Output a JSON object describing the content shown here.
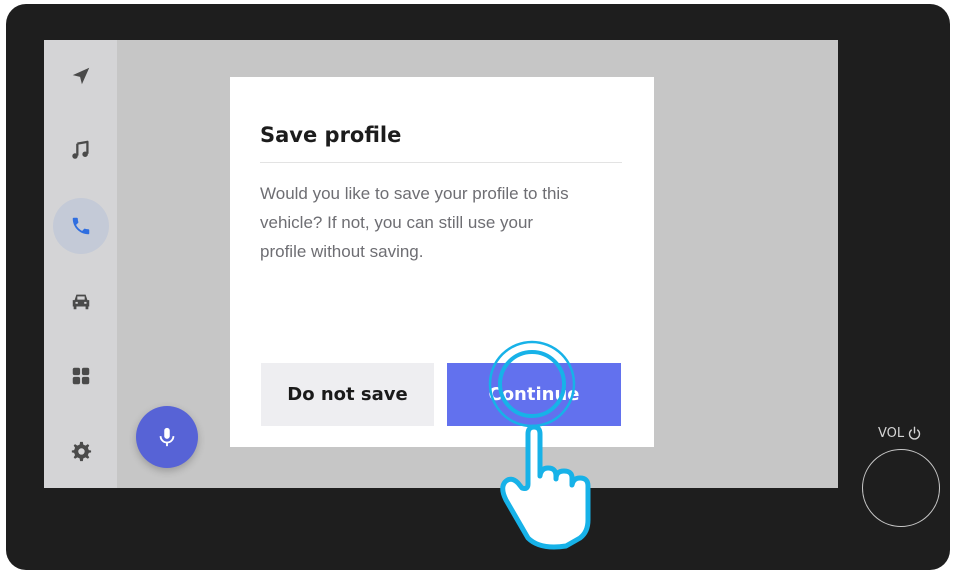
{
  "sidebar": {
    "items": [
      {
        "icon": "navigation-arrow-icon",
        "active": false
      },
      {
        "icon": "music-note-icon",
        "active": false
      },
      {
        "icon": "phone-icon",
        "active": true
      },
      {
        "icon": "car-icon",
        "active": false
      },
      {
        "icon": "apps-grid-icon",
        "active": false
      },
      {
        "icon": "settings-gear-icon",
        "active": false
      }
    ]
  },
  "voice_button": {
    "icon": "microphone-icon"
  },
  "dialog": {
    "title": "Save profile",
    "body": "Would you like to save your profile to this vehicle? If not, you can still use your profile without saving.",
    "secondary_label": "Do not save",
    "primary_label": "Continue"
  },
  "hardware": {
    "volume_label": "VOL",
    "power_icon": "power-icon"
  },
  "colors": {
    "accent": "#6271ee",
    "active_icon": "#2f6ee0",
    "touch_highlight": "#17b2e8",
    "screen_bg": "#c6c6c6",
    "device_frame": "#1e1e1e"
  }
}
